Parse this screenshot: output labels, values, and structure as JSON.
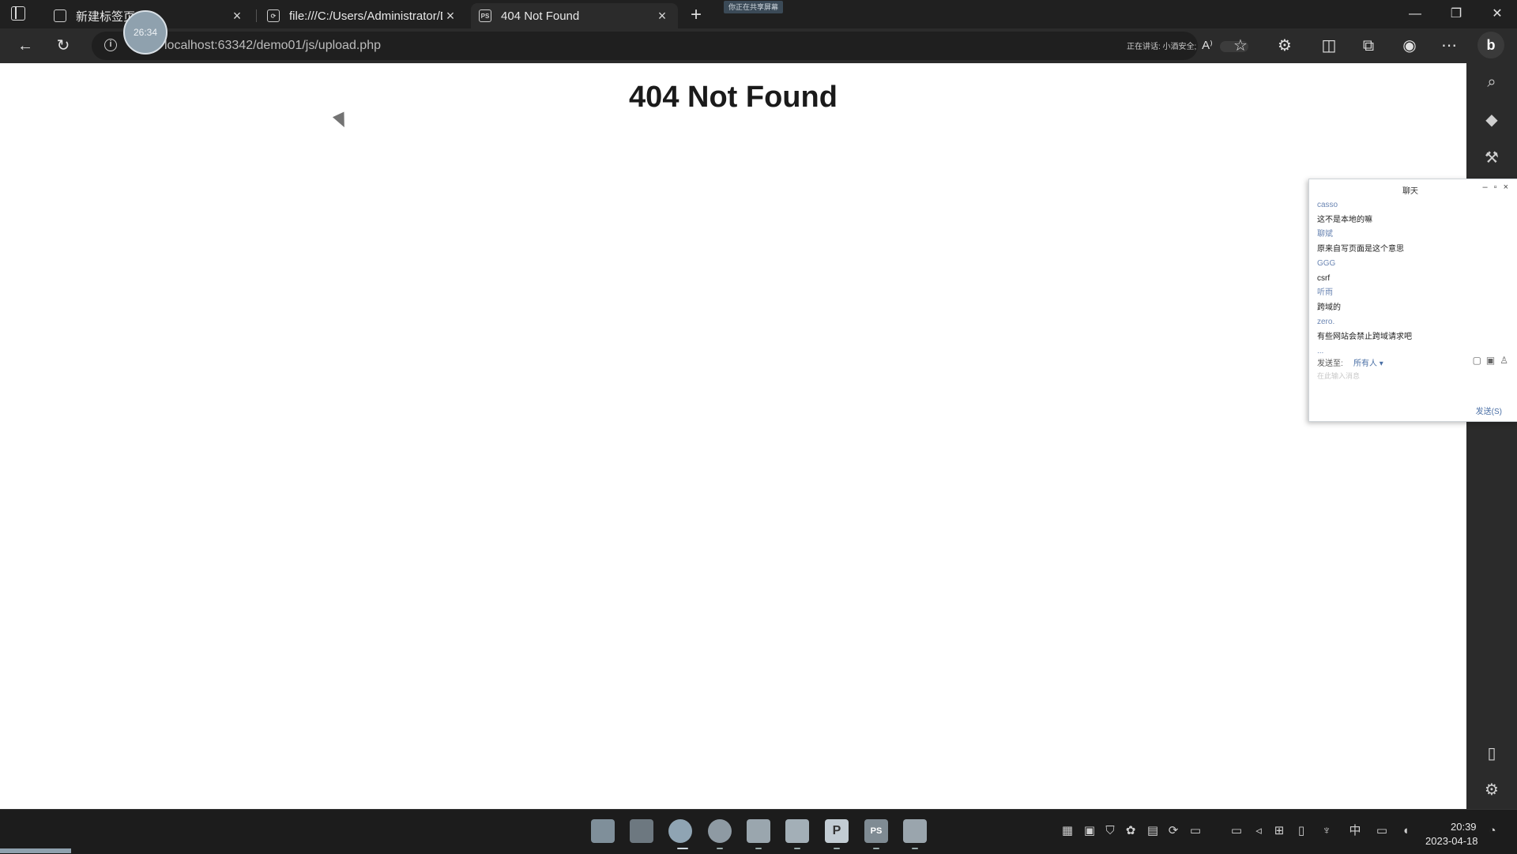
{
  "browser": {
    "tabs": [
      {
        "title": "新建标签页",
        "icon": "newtab-page-icon",
        "active": false
      },
      {
        "title": "file:///C:/Users/Administrator/De",
        "icon": "file-page-icon",
        "active": false
      },
      {
        "title": "404 Not Found",
        "icon": "phpstorm-page-icon",
        "active": true
      }
    ],
    "new_tab": "+",
    "share_badge": "你正在共享屏幕",
    "url": "localhost:63342/demo01/js/upload.php",
    "timer": "26:34",
    "speaking_status": "正在讲话: 小酒安全;",
    "window_controls": {
      "minimize": "—",
      "restore": "❐",
      "close": "✕"
    }
  },
  "page": {
    "heading": "404 Not Found"
  },
  "chat": {
    "title": "聊天",
    "messages": [
      {
        "type": "name",
        "text": "casso"
      },
      {
        "type": "text",
        "text": "这不是本地的嘛"
      },
      {
        "type": "name",
        "text": "聊斌"
      },
      {
        "type": "text",
        "text": "原来自写页面是这个意思"
      },
      {
        "type": "name",
        "text": "GGG"
      },
      {
        "type": "text",
        "text": "csrf"
      },
      {
        "type": "name",
        "text": "听雨"
      },
      {
        "type": "text",
        "text": "跨域的"
      },
      {
        "type": "name",
        "text": "zero."
      },
      {
        "type": "text",
        "text": "有些网站会禁止跨域请求吧"
      },
      {
        "type": "name",
        "text": "..."
      }
    ],
    "send_to_label": "发送至:",
    "send_to_value": "所有人 ▾",
    "input_placeholder": "在此输入消息",
    "send_button": "发送(S)"
  },
  "taskbar": {
    "clock_time": "20:39",
    "clock_date": "2023-04-18",
    "ime": "中"
  }
}
